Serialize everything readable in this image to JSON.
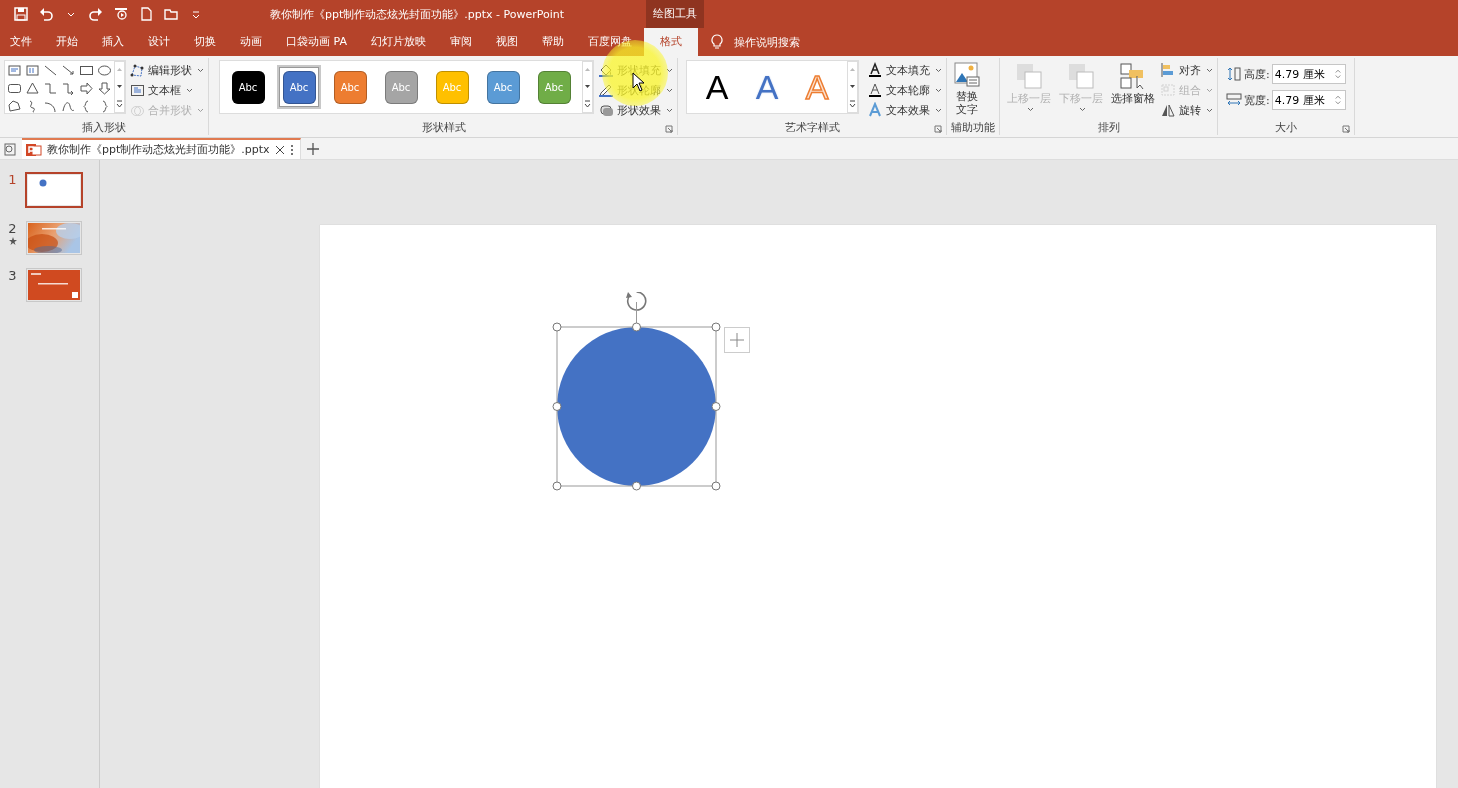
{
  "window": {
    "title": "教你制作《ppt制作动态炫光封面功能》.pptx  -  PowerPoint",
    "context_group": "绘图工具"
  },
  "menu_tabs": [
    {
      "label": "文件",
      "selected": false
    },
    {
      "label": "开始",
      "selected": false
    },
    {
      "label": "插入",
      "selected": false
    },
    {
      "label": "设计",
      "selected": false
    },
    {
      "label": "切换",
      "selected": false
    },
    {
      "label": "动画",
      "selected": false
    },
    {
      "label": "口袋动画 PA",
      "selected": false
    },
    {
      "label": "幻灯片放映",
      "selected": false
    },
    {
      "label": "审阅",
      "selected": false
    },
    {
      "label": "视图",
      "selected": false
    },
    {
      "label": "帮助",
      "selected": false
    },
    {
      "label": "百度网盘",
      "selected": false
    },
    {
      "label": "格式",
      "selected": true
    }
  ],
  "tell_me": "操作说明搜索",
  "ribbon": {
    "insert_shapes": {
      "label": "插入形状",
      "commands": [
        {
          "label": "编辑形状",
          "disabled": false
        },
        {
          "label": "文本框",
          "disabled": false
        },
        {
          "label": "合并形状",
          "disabled": true
        }
      ]
    },
    "shape_styles": {
      "label": "形状样式",
      "swatches": [
        {
          "text": "Abc",
          "color": "#000000",
          "selected": false
        },
        {
          "text": "Abc",
          "color": "#4472c4",
          "selected": true
        },
        {
          "text": "Abc",
          "color": "#ed7d31",
          "selected": false
        },
        {
          "text": "Abc",
          "color": "#a5a5a5",
          "selected": false
        },
        {
          "text": "Abc",
          "color": "#ffc000",
          "selected": false
        },
        {
          "text": "Abc",
          "color": "#5b9bd5",
          "selected": false
        },
        {
          "text": "Abc",
          "color": "#70ad47",
          "selected": false
        }
      ],
      "commands": [
        {
          "label": "形状填充",
          "kind": "fill"
        },
        {
          "label": "形状轮廓",
          "kind": "outline"
        },
        {
          "label": "形状效果",
          "kind": "effect"
        }
      ]
    },
    "wordart": {
      "label": "艺术字样式",
      "samples": [
        {
          "text": "A",
          "kind": "solid"
        },
        {
          "text": "A",
          "kind": "blue-outline"
        },
        {
          "text": "A",
          "kind": "orange-outline"
        }
      ],
      "commands": [
        {
          "label": "文本填充",
          "kind": "fill"
        },
        {
          "label": "文本轮廓",
          "kind": "outline"
        },
        {
          "label": "文本效果",
          "kind": "effect"
        }
      ]
    },
    "accessibility": {
      "label": "辅助功能",
      "button": [
        "替换",
        "文字"
      ]
    },
    "arrange": {
      "label": "排列",
      "large": [
        {
          "label": "上移一层",
          "disabled": true
        },
        {
          "label": "下移一层",
          "disabled": true
        },
        {
          "label": "选择窗格",
          "disabled": false
        }
      ],
      "small": [
        {
          "label": "对齐",
          "disabled": false,
          "kind": "align"
        },
        {
          "label": "组合",
          "disabled": true,
          "kind": "group"
        },
        {
          "label": "旋转",
          "disabled": false,
          "kind": "rotate"
        }
      ]
    },
    "size": {
      "label": "大小",
      "fields": [
        {
          "label": "高度:",
          "value": "4.79 厘米",
          "kind": "height"
        },
        {
          "label": "宽度:",
          "value": "4.79 厘米",
          "kind": "width"
        }
      ]
    }
  },
  "document_tab": {
    "title": "教你制作《ppt制作动态炫光封面功能》.pptx"
  },
  "slides": [
    {
      "number": "1",
      "selected": true,
      "kind": "circle",
      "animated": false
    },
    {
      "number": "2",
      "selected": false,
      "kind": "picture",
      "animated": true
    },
    {
      "number": "3",
      "selected": false,
      "kind": "red",
      "animated": false
    }
  ],
  "canvas": {
    "shape": {
      "kind": "circle",
      "color": "#4472c4",
      "selected": true
    }
  }
}
